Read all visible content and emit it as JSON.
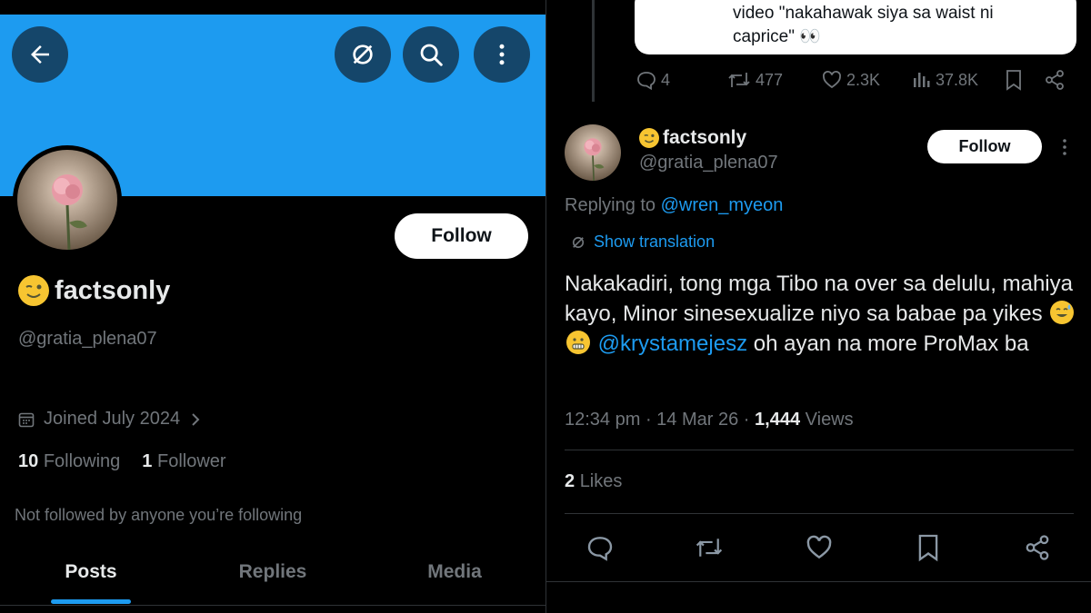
{
  "colors": {
    "banner": "#1d9bf0",
    "accent": "#1d9bf0",
    "muted": "#71767b",
    "text": "#e7e9ea",
    "background": "#000000"
  },
  "left": {
    "header_icons": [
      "back-arrow-icon",
      "translate-icon",
      "search-icon",
      "more-vertical-icon"
    ],
    "follow_label": "Follow",
    "display_name": "factsonly",
    "handle": "@gratia_plena07",
    "joined": "Joined July 2024",
    "following_count": "10",
    "following_label": "Following",
    "followers_count": "1",
    "followers_label": "Follower",
    "not_followed": "Not followed by anyone you’re following",
    "tabs": [
      {
        "label": "Posts",
        "active": true
      },
      {
        "label": "Replies",
        "active": false
      },
      {
        "label": "Media",
        "active": false
      }
    ]
  },
  "right": {
    "quoted_text_line1": "video \"nakahawak siya sa waist ni",
    "quoted_text_line2": "caprice\" 👀",
    "parent_actions": {
      "replies": "4",
      "reposts": "477",
      "likes": "2.3K",
      "views": "37.8K"
    },
    "display_name": "factsonly",
    "handle": "@gratia_plena07",
    "follow_label": "Follow",
    "replying_prefix": "Replying to",
    "replying_to": "@wren_myeon",
    "show_translation": "Show translation",
    "tweet_part1": "Nakakadiri, tong mga Tibo na over sa delulu, mahiya kayo, Minor sinesexualize niyo sa babae pa yikes",
    "tweet_mention": "@krystamejesz",
    "tweet_part2": "oh ayan na more ProMax ba",
    "time": "12:34 pm",
    "date": "14 Mar 26",
    "views_count": "1,444",
    "views_label": "Views",
    "likes_count": "2",
    "likes_label": "Likes",
    "bottom_icons": [
      "reply-icon",
      "repost-icon",
      "like-icon",
      "bookmark-icon",
      "share-icon"
    ]
  }
}
